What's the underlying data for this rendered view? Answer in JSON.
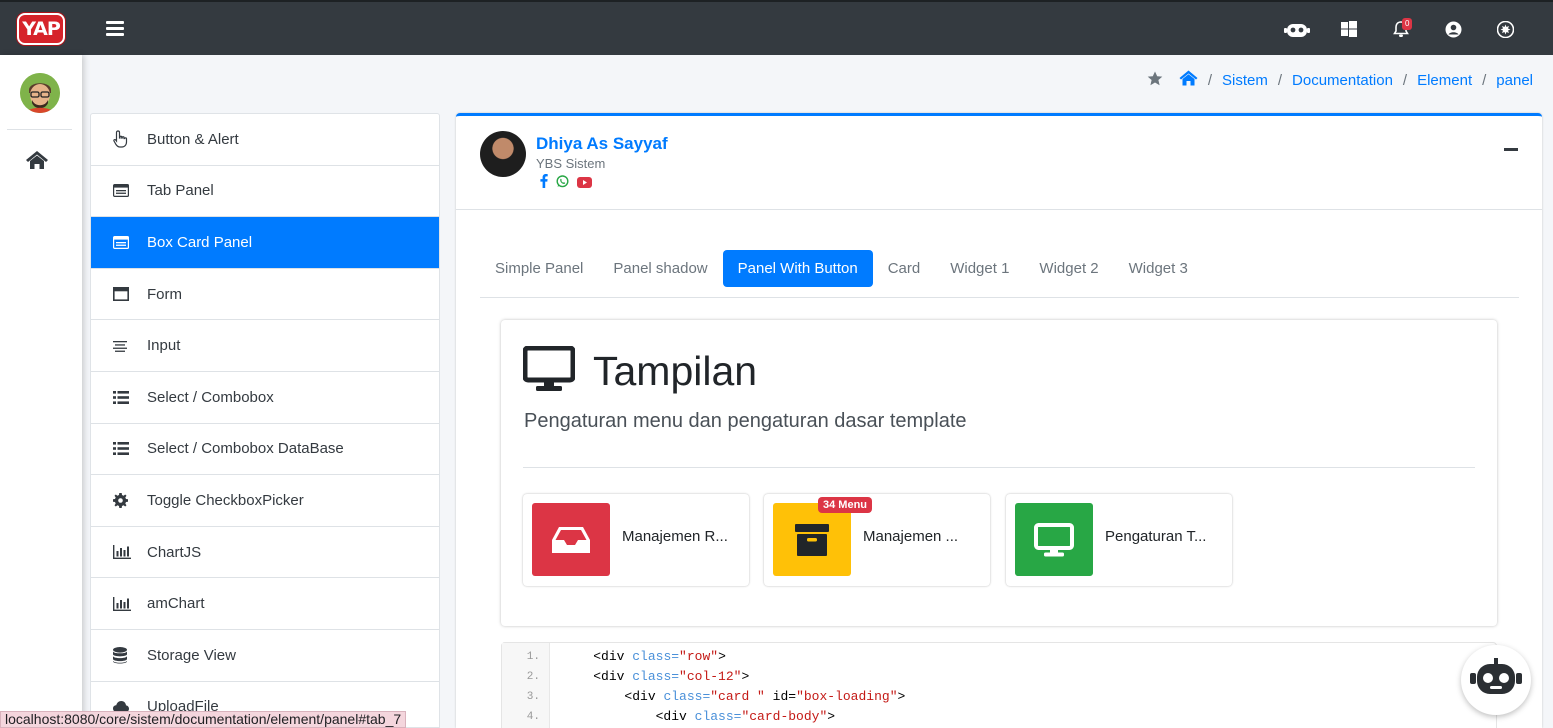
{
  "brand": {
    "logo_text": "YAP",
    "color": "#d6232a"
  },
  "header": {
    "notifications_count": "0",
    "icons": [
      "robot-icon",
      "windows-icon",
      "bell-icon",
      "user-circle-icon",
      "settings-icon"
    ]
  },
  "breadcrumb": {
    "items": [
      "Sistem",
      "Documentation",
      "Element",
      "panel"
    ]
  },
  "menu": {
    "items": [
      {
        "label": "Button & Alert",
        "icon": "pointer-hand-icon"
      },
      {
        "label": "Tab Panel",
        "icon": "tab-panel-icon"
      },
      {
        "label": "Box Card Panel",
        "icon": "card-panel-icon",
        "active": true
      },
      {
        "label": "Form",
        "icon": "window-icon"
      },
      {
        "label": "Input",
        "icon": "align-icon"
      },
      {
        "label": "Select / Combobox",
        "icon": "list-icon"
      },
      {
        "label": "Select / Combobox DataBase",
        "icon": "list-icon"
      },
      {
        "label": "Toggle CheckboxPicker",
        "icon": "gear-icon"
      },
      {
        "label": "ChartJS",
        "icon": "bar-chart-icon"
      },
      {
        "label": "amChart",
        "icon": "bar-chart-icon"
      },
      {
        "label": "Storage View",
        "icon": "database-icon"
      },
      {
        "label": "UploadFile",
        "icon": "upload-icon"
      }
    ]
  },
  "profile": {
    "name": "Dhiya As Sayyaf",
    "subtitle": "YBS Sistem"
  },
  "tabs": {
    "items": [
      "Simple Panel",
      "Panel shadow",
      "Panel With Button",
      "Card",
      "Widget 1",
      "Widget 2",
      "Widget 3"
    ],
    "active": "Panel With Button"
  },
  "panel": {
    "title": "Tampilan",
    "description": "Pengaturan menu dan pengaturan dasar template",
    "tiles": [
      {
        "label": "Manajemen R...",
        "color": "#dc3545",
        "icon": "inbox-icon"
      },
      {
        "label": "Manajemen ...",
        "color": "#ffc107",
        "icon": "archive-icon",
        "badge": "34 Menu"
      },
      {
        "label": "Pengaturan T...",
        "color": "#28a745",
        "icon": "monitor-icon"
      }
    ]
  },
  "code": {
    "lines": [
      {
        "n": "1.",
        "indent": "    ",
        "tag": "<div ",
        "attr": "class=",
        "val": "\"row\"",
        "rest": ">"
      },
      {
        "n": "2.",
        "indent": "    ",
        "tag": "<div ",
        "attr": "class=",
        "val": "\"col-12\"",
        "rest": ">"
      },
      {
        "n": "3.",
        "indent": "        ",
        "tag": "<div ",
        "attr": "class=",
        "val": "\"card \"",
        "rest": " id=",
        "val2": "\"box-loading\"",
        "rest2": ">"
      },
      {
        "n": "4.",
        "indent": "            ",
        "tag": "<div ",
        "attr": "class=",
        "val": "\"card-body\"",
        "rest": ">"
      }
    ]
  },
  "status_bar": {
    "url": "localhost:8080/core/sistem/documentation/element/panel#tab_7"
  }
}
